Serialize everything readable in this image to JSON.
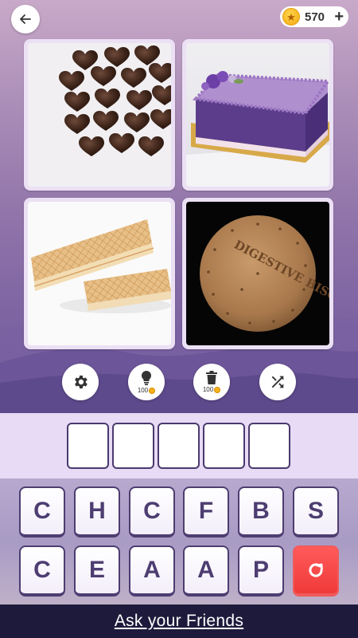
{
  "header": {
    "back_icon": "arrow-left-icon",
    "coins": {
      "icon": "star-coin-icon",
      "count": "570",
      "add_label": "+"
    }
  },
  "puzzle": {
    "images": [
      {
        "subject": "chocolate-hearts"
      },
      {
        "subject": "purple-cake"
      },
      {
        "subject": "wafer-biscuits"
      },
      {
        "subject": "digestive-biscuit",
        "printed_text": "DIGESTIVE BISCUITS"
      }
    ]
  },
  "tools": [
    {
      "icon": "gear-icon",
      "cost": ""
    },
    {
      "icon": "lightbulb-icon",
      "cost": "100"
    },
    {
      "icon": "trash-icon",
      "cost": "100"
    },
    {
      "icon": "shuffle-icon",
      "cost": ""
    }
  ],
  "answer": {
    "slots": [
      "",
      "",
      "",
      "",
      ""
    ]
  },
  "keyboard": {
    "row1": [
      "C",
      "H",
      "C",
      "F",
      "B",
      "S"
    ],
    "row2": [
      "C",
      "E",
      "A",
      "A",
      "P"
    ],
    "reset_icon": "reset-icon"
  },
  "footer": {
    "ask_label": "Ask your Friends"
  },
  "colors": {
    "key_text": "#4d3d71",
    "reset_key": "#f04444",
    "footer_bg": "#1e1a3c",
    "answer_bg": "#e7dbf5"
  }
}
